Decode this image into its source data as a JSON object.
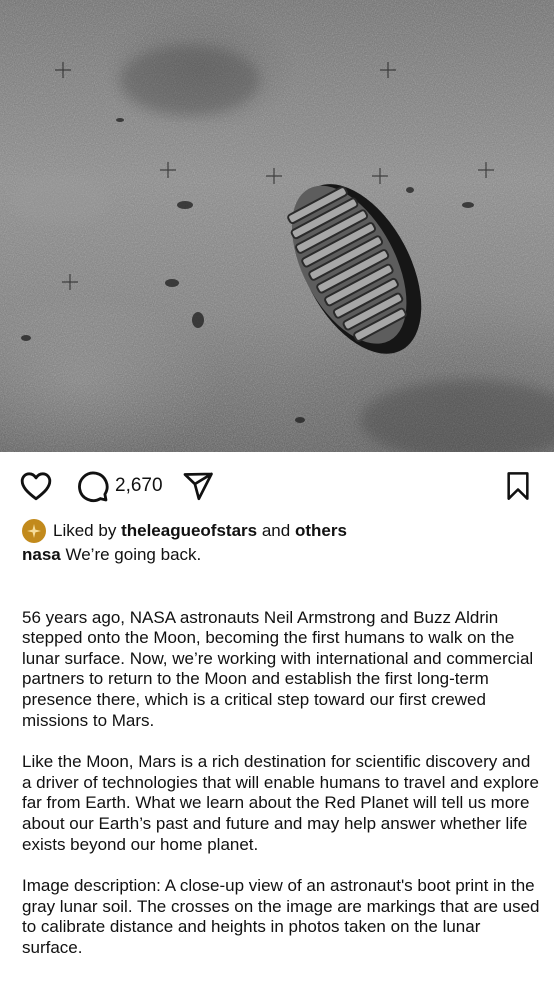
{
  "post": {
    "image_alt": "Astronaut boot print in lunar soil",
    "comment_count": "2,670",
    "liked_by_prefix": "Liked by",
    "liked_by_user": "theleagueofstars",
    "liked_by_and": "and",
    "liked_by_others": "others",
    "username": "nasa",
    "caption_first": "We’re going back.",
    "paragraphs": [
      "56 years ago, NASA astronauts Neil Armstrong and Buzz Aldrin stepped onto the Moon, becoming the first humans to walk on the lunar surface. Now, we’re working with international and commercial partners to return to the Moon and establish the first long-term presence there, which is a critical step toward our first crewed missions to Mars.",
      "Like the Moon, Mars is a rich destination for scientific discovery and a driver of technologies that will enable humans to travel and explore far from Earth. What we learn about the Red Planet will tell us more about our Earth’s past and future and may help answer whether life exists beyond our home planet.",
      "Image description: A close-up view of an astronaut's boot print in the gray lunar soil. The crosses on the image are markings that are used to calibrate distance and heights in photos taken on the lunar surface."
    ]
  },
  "icons": {
    "like": "heart-icon",
    "comment": "comment-bubble-icon",
    "share": "paper-plane-icon",
    "save": "bookmark-icon",
    "avatar": "star-badge-icon"
  },
  "colors": {
    "text": "#111111",
    "avatar_bg": "#c28a1c"
  }
}
